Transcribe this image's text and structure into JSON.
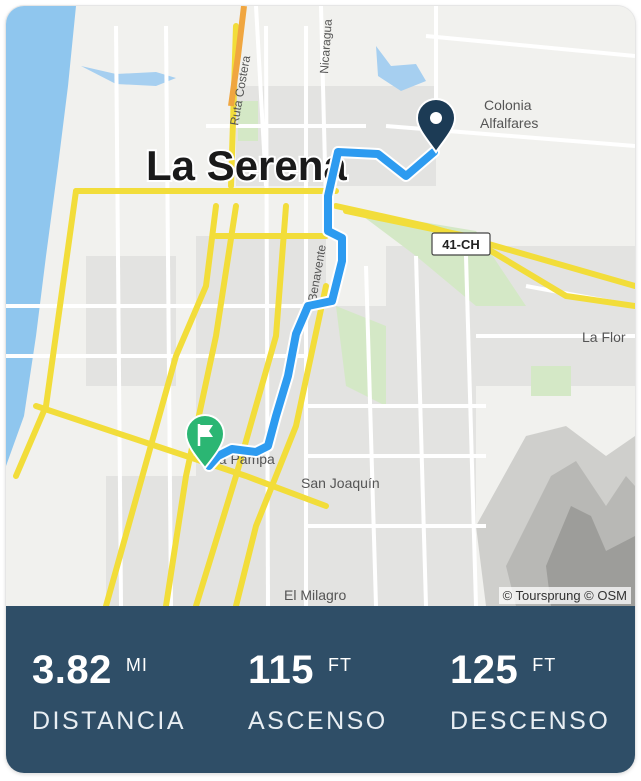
{
  "map": {
    "city_label": "La Serena",
    "place_labels": {
      "colonia": "Colonia",
      "alfalfares": "Alfalfares",
      "la_flor": "La Flor",
      "san_joaquin": "San Joaquín",
      "el_milagro": "El Milagro",
      "la_pampa": "La Pampa",
      "benavente": "Benavente",
      "ruta_costera": "Ruta Costera",
      "nicaragua": "Nicaragua"
    },
    "route_shield": "41-CH",
    "attribution": "© Toursprung © OSM",
    "colors": {
      "route": "#2d9bf0",
      "major_road": "#f2dd3a",
      "water": "#8fc6ee",
      "start_marker": "#1c3b55",
      "finish_marker": "#2bb673"
    }
  },
  "stats": [
    {
      "value": "3.82",
      "unit": "MI",
      "label": "DISTANCIA"
    },
    {
      "value": "115",
      "unit": "FT",
      "label": "ASCENSO"
    },
    {
      "value": "125",
      "unit": "FT",
      "label": "DESCENSO"
    }
  ]
}
